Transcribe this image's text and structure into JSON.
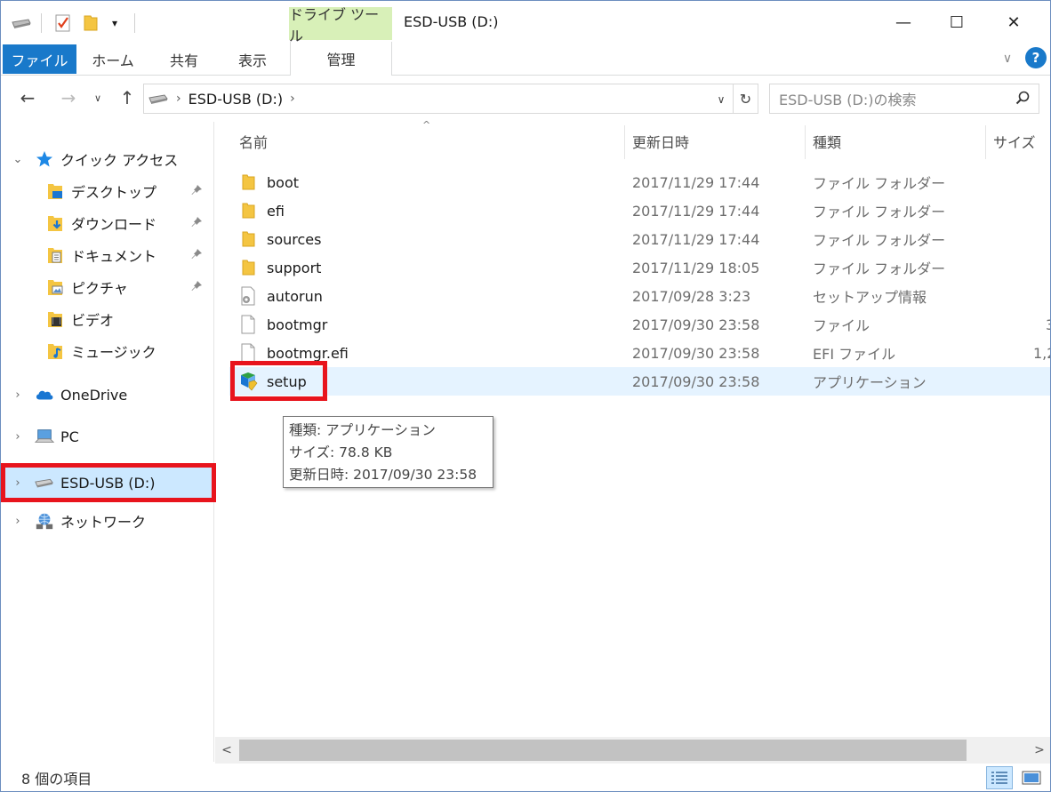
{
  "titlebar": {
    "context_tab": "ドライブ ツール",
    "title": "ESD-USB (D:)",
    "quick_access_dropdown": "▾",
    "minimize": "—",
    "maximize": "☐",
    "close": "✕"
  },
  "ribbon": {
    "tabs": [
      "ファイル",
      "ホーム",
      "共有",
      "表示",
      "管理"
    ],
    "expand": "∨",
    "help": "?"
  },
  "address": {
    "back": "←",
    "forward": "→",
    "recent": "∨",
    "up": "↑",
    "chevron": "›",
    "path_segment": "ESD-USB (D:)",
    "trailing_chevron": "›",
    "dropdown": "∨",
    "refresh": "↻",
    "search_placeholder": "ESD-USB (D:)の検索",
    "search_icon": "⚲"
  },
  "navpane": {
    "quick_access": "クイック アクセス",
    "quick_items": [
      {
        "label": "デスクトップ",
        "icon": "desktop-folder-icon",
        "pinned": true
      },
      {
        "label": "ダウンロード",
        "icon": "downloads-folder-icon",
        "pinned": true
      },
      {
        "label": "ドキュメント",
        "icon": "documents-folder-icon",
        "pinned": true
      },
      {
        "label": "ピクチャ",
        "icon": "pictures-folder-icon",
        "pinned": true
      },
      {
        "label": "ビデオ",
        "icon": "videos-folder-icon",
        "pinned": false
      },
      {
        "label": "ミュージック",
        "icon": "music-folder-icon",
        "pinned": false
      }
    ],
    "onedrive": "OneDrive",
    "pc": "PC",
    "esd_usb": "ESD-USB (D:)",
    "network": "ネットワーク",
    "pin_glyph": "📌",
    "expand_glyph": "›",
    "collapse_glyph": "⌄"
  },
  "columns": {
    "name": "名前",
    "date": "更新日時",
    "type": "種類",
    "size": "サイズ",
    "sort_caret": "^"
  },
  "files": [
    {
      "name": "boot",
      "date": "2017/11/29 17:44",
      "type": "ファイル フォルダー",
      "size": "",
      "icon": "folder-icon"
    },
    {
      "name": "efi",
      "date": "2017/11/29 17:44",
      "type": "ファイル フォルダー",
      "size": "",
      "icon": "folder-icon"
    },
    {
      "name": "sources",
      "date": "2017/11/29 17:44",
      "type": "ファイル フォルダー",
      "size": "",
      "icon": "folder-icon"
    },
    {
      "name": "support",
      "date": "2017/11/29 18:05",
      "type": "ファイル フォルダー",
      "size": "",
      "icon": "folder-icon"
    },
    {
      "name": "autorun",
      "date": "2017/09/28 3:23",
      "type": "セットアップ情報",
      "size": "",
      "icon": "settings-file-icon"
    },
    {
      "name": "bootmgr",
      "date": "2017/09/30 23:58",
      "type": "ファイル",
      "size": "3",
      "icon": "file-icon"
    },
    {
      "name": "bootmgr.efi",
      "date": "2017/09/30 23:58",
      "type": "EFI ファイル",
      "size": "1,2",
      "icon": "file-icon"
    },
    {
      "name": "setup",
      "date": "2017/09/30 23:58",
      "type": "アプリケーション",
      "size": "",
      "icon": "setup-app-icon"
    }
  ],
  "tooltip": {
    "line1": "種類: アプリケーション",
    "line2": "サイズ: 78.8 KB",
    "line3": "更新日時: 2017/09/30 23:58"
  },
  "scrollbar": {
    "left": "<",
    "right": ">"
  },
  "status": {
    "count": "8 個の項目"
  },
  "colors": {
    "accent": "#1979ca",
    "context_tab": "#d8f0b8",
    "selection": "#cce8ff",
    "hover_row": "#e5f3ff",
    "highlight_frame": "#e8141d",
    "folder": "#f4c542"
  }
}
